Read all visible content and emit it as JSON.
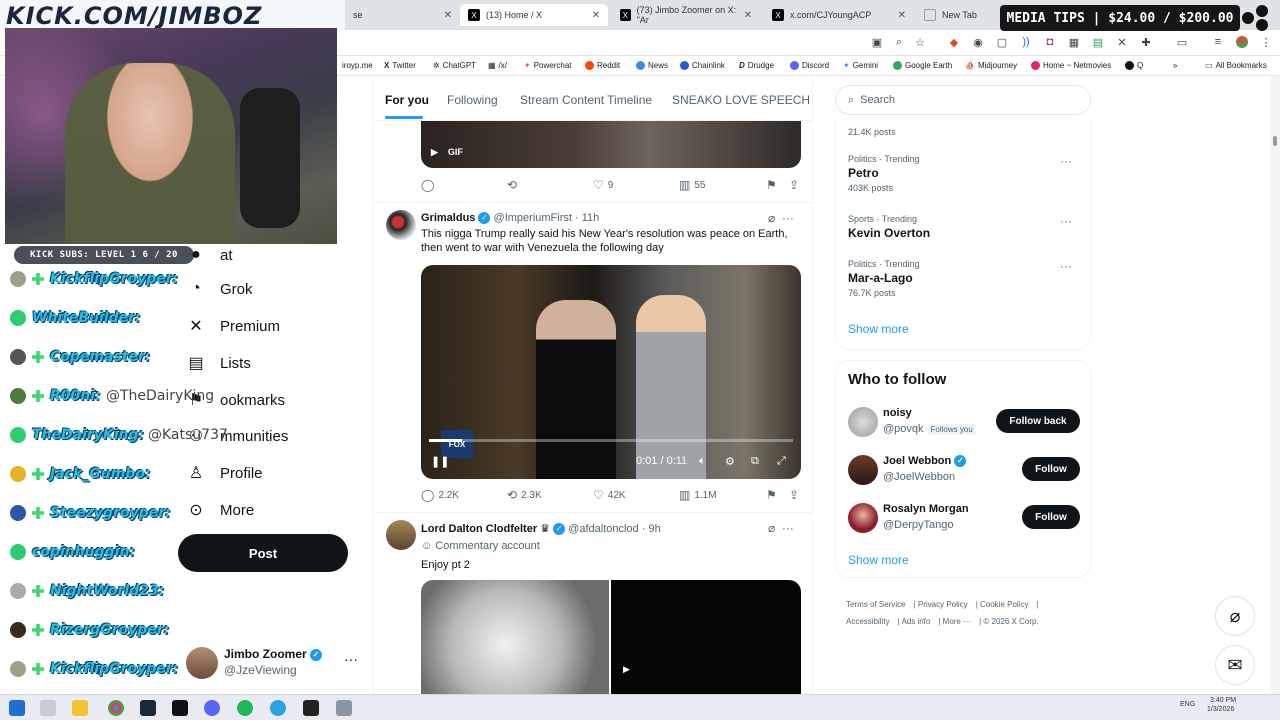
{
  "overlay": {
    "url": "KICK.COM/JIMBOZ",
    "media_tips": "MEDIA TIPS | $24.00 / $200.00",
    "kick_subs": "KICK SUBS: LEVEL 1 6 / 20"
  },
  "browser": {
    "tabs": [
      {
        "label": "(13) Home / X"
      },
      {
        "label": "(73) Jimbo Zoomer on X: \"Ar"
      },
      {
        "label": "x.com/CJYoungACP"
      },
      {
        "label": "New Tab"
      }
    ],
    "bookmarks": [
      "Twitter",
      "ChatGPT",
      "/x/",
      "Powerchat",
      "Reddit",
      "News",
      "Chainlink",
      "Drudge",
      "Discord",
      "Gemini",
      "Google Earth",
      "Midjourney",
      "Home ~ Netmovies",
      "Q",
      "All Bookmarks"
    ],
    "partial_bookmark": "iroyp.me",
    "partial_tab": "se"
  },
  "chat": [
    {
      "name": "KickflipGroyper:",
      "color": "#3cd96b"
    },
    {
      "name": "WhiteBuilder:",
      "color": "#3cd96b"
    },
    {
      "name": "Copemaster:",
      "color": "#3cd96b"
    },
    {
      "name": "R00ni:",
      "msg": "@TheDairyKing",
      "color": "#3cd96b"
    },
    {
      "name": "TheDairyKing:",
      "msg": "@Katsu737",
      "color": "#3cd96b"
    },
    {
      "name": "Jack_Gumbo:",
      "color": "#3cd96b"
    },
    {
      "name": "Steezygroyper:",
      "color": "#3cd96b"
    },
    {
      "name": "copinhuggin:",
      "color": "#3cd96b"
    },
    {
      "name": "NightWorld23:",
      "color": "#3cd96b"
    },
    {
      "name": "RizergGroyper:",
      "color": "#3cd96b"
    },
    {
      "name": "KickflipGroyper:",
      "color": "#3cd96b"
    }
  ],
  "nav": {
    "items": [
      {
        "label": "at",
        "icon": "chat-icon"
      },
      {
        "label": "Grok",
        "icon": "grok-icon"
      },
      {
        "label": "Premium",
        "icon": "x-premium-icon"
      },
      {
        "label": "Lists",
        "icon": "list-icon"
      },
      {
        "label": "ookmarks",
        "icon": "bookmark-icon"
      },
      {
        "label": "mmunities",
        "icon": "communities-icon"
      },
      {
        "label": "Profile",
        "icon": "profile-icon"
      },
      {
        "label": "More",
        "icon": "more-icon"
      }
    ],
    "post_label": "Post",
    "account": {
      "name": "Jimbo Zoomer",
      "handle": "@JzeViewing"
    }
  },
  "timeline": {
    "tabs": [
      "For you",
      "Following",
      "Stream Content Timeline",
      "SNEAKO LOVE SPEECH"
    ],
    "gif_post": {
      "gif_label": "GIF",
      "replies": "",
      "reposts": "",
      "likes": "9",
      "views": "55"
    },
    "post1": {
      "name": "Grimaldus",
      "handle": "@ImperiumFirst",
      "time": "11h",
      "text": "This nigga Trump really said his New Year's resolution was peace on Earth, then went to war with Venezuela the following day",
      "video_time": "0:01 / 0:11",
      "video_progress": 0.09,
      "replies": "2.2K",
      "reposts": "2.3K",
      "likes": "42K",
      "views": "1.1M"
    },
    "post2": {
      "name": "Lord Dalton Clodfelter",
      "handle": "@afdaltonclod",
      "time": "9h",
      "label": "Commentary account",
      "text": "Enjoy pt 2"
    }
  },
  "sidebar": {
    "search_placeholder": "Search",
    "top_count": "21.4K posts",
    "trends": [
      {
        "category": "Politics · Trending",
        "title": "Petro",
        "count": "403K posts"
      },
      {
        "category": "Sports · Trending",
        "title": "Kevin Overton",
        "count": ""
      },
      {
        "category": "Politics · Trending",
        "title": "Mar-a-Lago",
        "count": "76.7K posts"
      }
    ],
    "show_more": "Show more",
    "who_to_follow": {
      "title": "Who to follow",
      "accounts": [
        {
          "name": "noisy",
          "handle": "@povqk",
          "badge": "Follows you",
          "button": "Follow back"
        },
        {
          "name": "Joel Webbon",
          "handle": "@JoelWebbon",
          "badge": "",
          "button": "Follow"
        },
        {
          "name": "Rosalyn Morgan",
          "handle": "@DerpyTango",
          "badge": "",
          "button": "Follow"
        }
      ],
      "show_more": "Show more"
    },
    "footer": [
      "Terms of Service",
      "Privacy Policy",
      "Cookie Policy",
      "Accessibility",
      "Ads info",
      "More ···",
      "© 2026 X Corp."
    ]
  },
  "taskbar": {
    "lang": "ENG",
    "time": "3:40 PM",
    "date": "1/3/2026"
  },
  "colors": {
    "accent": "#1d9bf0",
    "chat_name": "#28c2e0"
  }
}
